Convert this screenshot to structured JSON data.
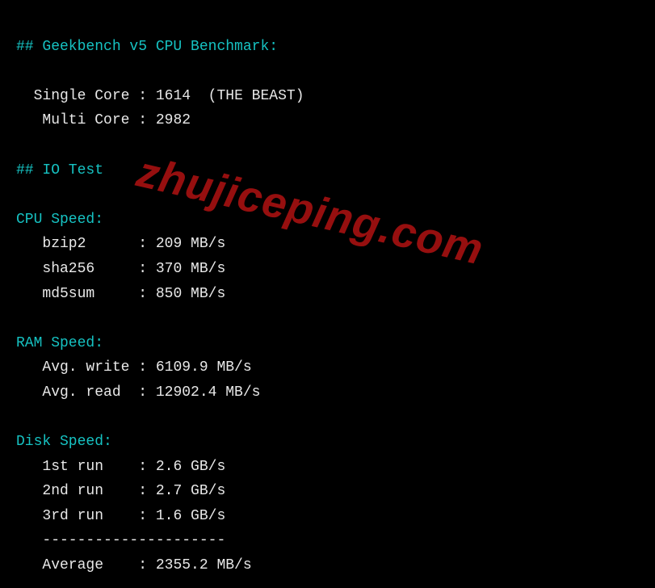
{
  "geekbench": {
    "header": "## Geekbench v5 CPU Benchmark:",
    "single_label": "Single Core",
    "single_value": "1614",
    "single_note": "(THE BEAST)",
    "multi_label": "Multi Core",
    "multi_value": "2982"
  },
  "io": {
    "header": "## IO Test",
    "cpu": {
      "label": "CPU Speed:",
      "rows": [
        {
          "name": "bzip2",
          "value": "209 MB/s"
        },
        {
          "name": "sha256",
          "value": "370 MB/s"
        },
        {
          "name": "md5sum",
          "value": "850 MB/s"
        }
      ]
    },
    "ram": {
      "label": "RAM Speed:",
      "rows": [
        {
          "name": "Avg. write",
          "value": "6109.9 MB/s"
        },
        {
          "name": "Avg. read",
          "value": "12902.4 MB/s"
        }
      ]
    },
    "disk": {
      "label": "Disk Speed:",
      "rows": [
        {
          "name": "1st run",
          "value": "2.6 GB/s"
        },
        {
          "name": "2nd run",
          "value": "2.7 GB/s"
        },
        {
          "name": "3rd run",
          "value": "1.6 GB/s"
        }
      ],
      "separator": "---------------------",
      "avg_label": "Average",
      "avg_value": "2355.2 MB/s"
    }
  },
  "watermark": "zhujiceping.com"
}
